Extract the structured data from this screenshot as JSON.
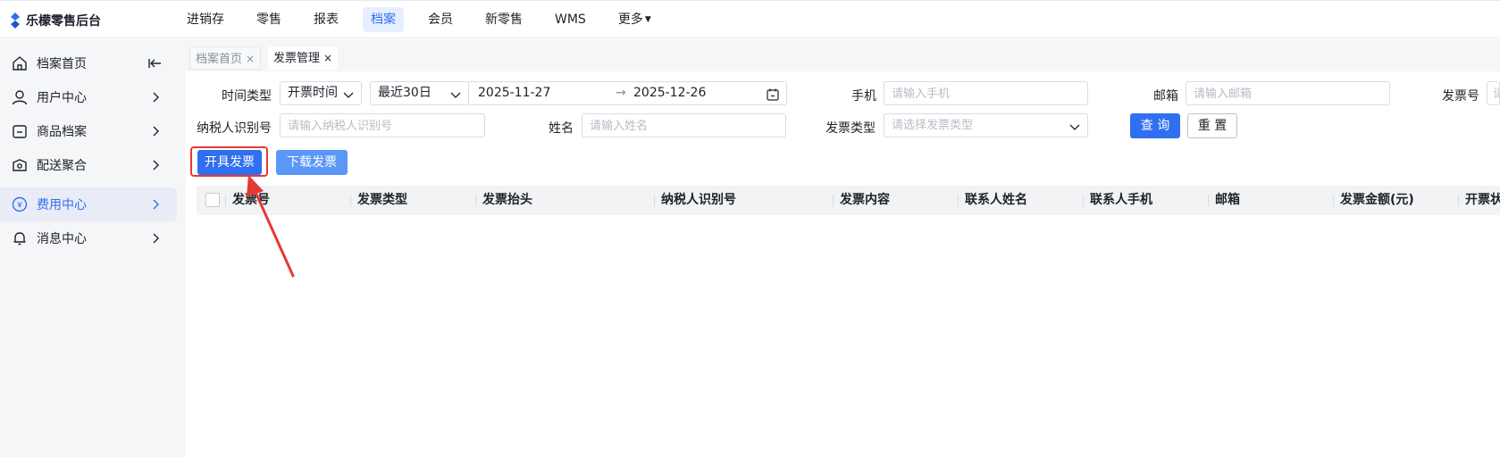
{
  "app": {
    "title": "乐檬零售后台",
    "brand_color": "#2f6ff0"
  },
  "topnav": [
    {
      "label": "进销存",
      "active": false
    },
    {
      "label": "零售",
      "active": false
    },
    {
      "label": "报表",
      "active": false
    },
    {
      "label": "档案",
      "active": true
    },
    {
      "label": "会员",
      "active": false
    },
    {
      "label": "新零售",
      "active": false
    },
    {
      "label": "WMS",
      "active": false
    },
    {
      "label": "更多",
      "active": false,
      "has_caret": true
    }
  ],
  "sidebar": {
    "items": [
      {
        "label": "档案首页",
        "icon": "home-icon",
        "trailing": "collapse-icon",
        "active": false
      },
      {
        "label": "用户中心",
        "icon": "user-icon",
        "trailing": "chevron-right-icon",
        "active": false
      },
      {
        "label": "商品档案",
        "icon": "product-icon",
        "trailing": "chevron-right-icon",
        "active": false
      },
      {
        "label": "配送聚合",
        "icon": "delivery-icon",
        "trailing": "chevron-right-icon",
        "active": false
      },
      {
        "label": "费用中心",
        "icon": "yen-icon",
        "trailing": "chevron-right-icon",
        "active": true
      },
      {
        "label": "消息中心",
        "icon": "bell-icon",
        "trailing": "chevron-right-icon",
        "active": false
      }
    ]
  },
  "tabs": [
    {
      "label": "档案首页",
      "close": "×",
      "active": false
    },
    {
      "label": "发票管理",
      "close": "×",
      "active": true
    }
  ],
  "filters": {
    "time_type_label": "时间类型",
    "time_type_value": "开票时间",
    "range_preset_value": "最近30日",
    "date_start": "2025-11-27",
    "date_sep": "→",
    "date_end": "2025-12-26",
    "phone_label": "手机",
    "phone_placeholder": "请输入手机",
    "email_label": "邮箱",
    "email_placeholder": "请输入邮箱",
    "invoice_no_label": "发票号",
    "invoice_no_placeholder": "请",
    "taxpayer_label": "纳税人识别号",
    "taxpayer_placeholder": "请输入纳税人识别号",
    "name_label": "姓名",
    "name_placeholder": "请输入姓名",
    "invoice_type_label": "发票类型",
    "invoice_type_placeholder": "请选择发票类型",
    "query_button": "查 询",
    "reset_button": "重 置"
  },
  "actions": {
    "issue_invoice": "开具发票",
    "download_invoice": "下载发票"
  },
  "table": {
    "columns": [
      "发票号",
      "发票类型",
      "发票抬头",
      "纳税人识别号",
      "发票内容",
      "联系人姓名",
      "联系人手机",
      "邮箱",
      "发票金额(元)",
      "开票状"
    ]
  },
  "annotation": {
    "color": "#e53935"
  }
}
